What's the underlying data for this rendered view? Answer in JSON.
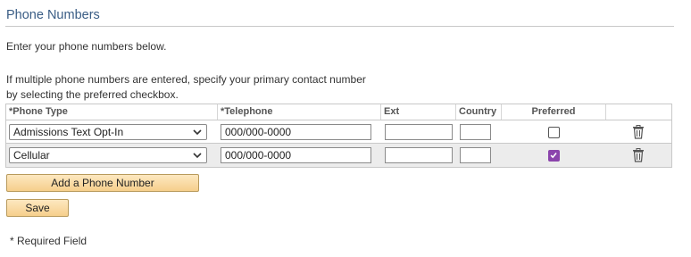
{
  "page": {
    "title": "Phone Numbers",
    "intro": "Enter your phone numbers below.",
    "instruction_line1": "If multiple phone numbers are entered, specify your primary contact number",
    "instruction_line2": "by selecting the preferred checkbox."
  },
  "table": {
    "headers": {
      "phone_type": "*Phone Type",
      "telephone": "*Telephone",
      "ext": "Ext",
      "country": "Country",
      "preferred": "Preferred"
    },
    "rows": [
      {
        "phone_type": "Admissions Text Opt-In",
        "telephone": "000/000-0000",
        "ext": "",
        "country": "",
        "preferred": false
      },
      {
        "phone_type": "Cellular",
        "telephone": "000/000-0000",
        "ext": "",
        "country": "",
        "preferred": true
      }
    ]
  },
  "buttons": {
    "add_phone": "Add a Phone Number",
    "save": "Save"
  },
  "footer": {
    "required_note": "* Required Field"
  },
  "colors": {
    "title": "#3a5d85",
    "checkbox_checked": "#8b44ac",
    "button_fill": "#f6cf8c"
  },
  "icons": {
    "delete": "trash-icon",
    "dropdown": "chevron-down-icon",
    "check": "checkmark-icon"
  }
}
